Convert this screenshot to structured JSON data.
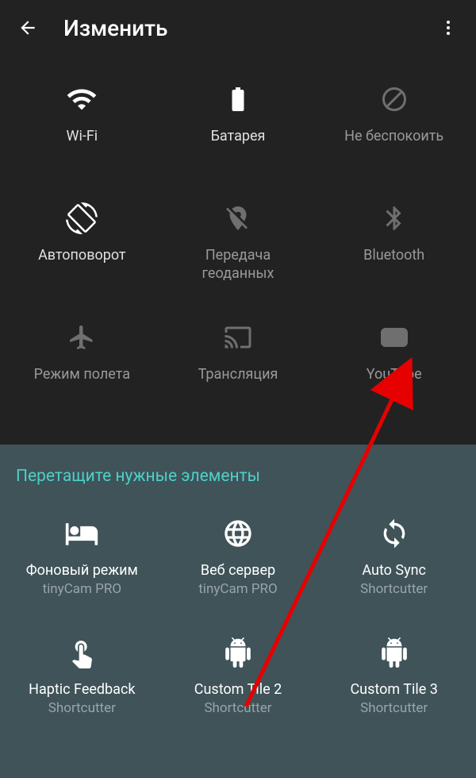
{
  "header": {
    "title": "Изменить"
  },
  "active_tiles": [
    {
      "id": "wifi",
      "label": "Wi-Fi",
      "dim": false
    },
    {
      "id": "battery",
      "label": "Батарея",
      "dim": false
    },
    {
      "id": "dnd",
      "label": "Не беспокоить",
      "dim": true
    },
    {
      "id": "rotate",
      "label": "Автоповорот",
      "dim": false
    },
    {
      "id": "location",
      "label": "Передача геоданных",
      "dim": true
    },
    {
      "id": "bluetooth",
      "label": "Bluetooth",
      "dim": true
    },
    {
      "id": "airplane",
      "label": "Режим полета",
      "dim": true
    },
    {
      "id": "cast",
      "label": "Трансляция",
      "dim": true
    },
    {
      "id": "youtube",
      "label": "YouTube",
      "dim": true
    }
  ],
  "drag_section": {
    "title": "Перетащите нужные элементы"
  },
  "available_tiles": [
    {
      "id": "bg",
      "label": "Фоновый режим",
      "sub": "tinyCam PRO"
    },
    {
      "id": "web",
      "label": "Веб сервер",
      "sub": "tinyCam PRO"
    },
    {
      "id": "sync",
      "label": "Auto Sync",
      "sub": "Shortcutter"
    },
    {
      "id": "haptic",
      "label": "Haptic Feedback",
      "sub": "Shortcutter"
    },
    {
      "id": "custom2",
      "label": "Custom Tile 2",
      "sub": "Shortcutter"
    },
    {
      "id": "custom3",
      "label": "Custom Tile 3",
      "sub": "Shortcutter"
    }
  ]
}
